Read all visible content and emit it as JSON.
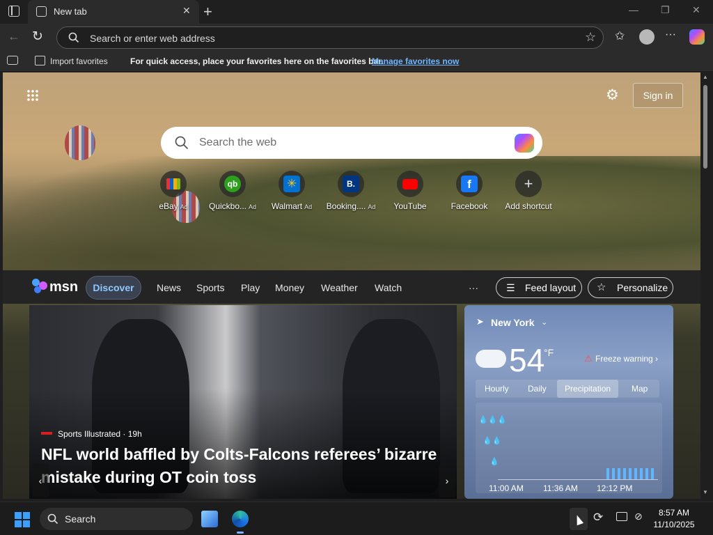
{
  "browser": {
    "tab": {
      "title": "New tab"
    },
    "address_bar": {
      "placeholder": "Search or enter web address"
    }
  },
  "favorites_bar": {
    "import_label": "Import favorites",
    "message": "For quick access, place your favorites here on the favorites bar.",
    "manage_link": "Manage favorites now"
  },
  "newtab": {
    "signin_label": "Sign in",
    "search_placeholder": "Search the web",
    "shortcuts": [
      {
        "label": "eBay",
        "ad": "Ad",
        "color": "#e53238"
      },
      {
        "label": "Quickbo...",
        "ad": "Ad",
        "color": "#2ca01c"
      },
      {
        "label": "Walmart",
        "ad": "Ad",
        "color": "#0071ce"
      },
      {
        "label": "Booking....",
        "ad": "Ad",
        "color": "#003580"
      },
      {
        "label": "YouTube",
        "ad": "",
        "color": "#ff0000"
      },
      {
        "label": "Facebook",
        "ad": "",
        "color": "#1877f2"
      },
      {
        "label": "Add shortcut",
        "ad": "",
        "color": "#888888"
      }
    ]
  },
  "msn": {
    "logo": "msn",
    "nav": [
      "Discover",
      "News",
      "Sports",
      "Play",
      "Money",
      "Weather",
      "Watch"
    ],
    "more": "···",
    "feed_layout": "Feed layout",
    "personalize": "Personalize"
  },
  "news": {
    "source": "Sports Illustrated",
    "age": "19h",
    "headline": "NFL world baffled by Colts-Falcons referees’ bizarre mistake during OT coin toss"
  },
  "weather": {
    "city": "New York",
    "temperature": "54",
    "unit": "°F",
    "alert": "Freeze warning",
    "tabs": [
      "Hourly",
      "Daily",
      "Precipitation",
      "Map"
    ],
    "selected_tab": "Precipitation",
    "time_labels": [
      "11:00 AM",
      "11:36 AM",
      "12:12 PM"
    ]
  },
  "taskbar": {
    "search_label": "Search",
    "time": "8:57 AM",
    "date": "11/10/2025"
  },
  "colors": {
    "accent_link": "#6fb5ff",
    "discover_active": "#8ec8ff"
  }
}
